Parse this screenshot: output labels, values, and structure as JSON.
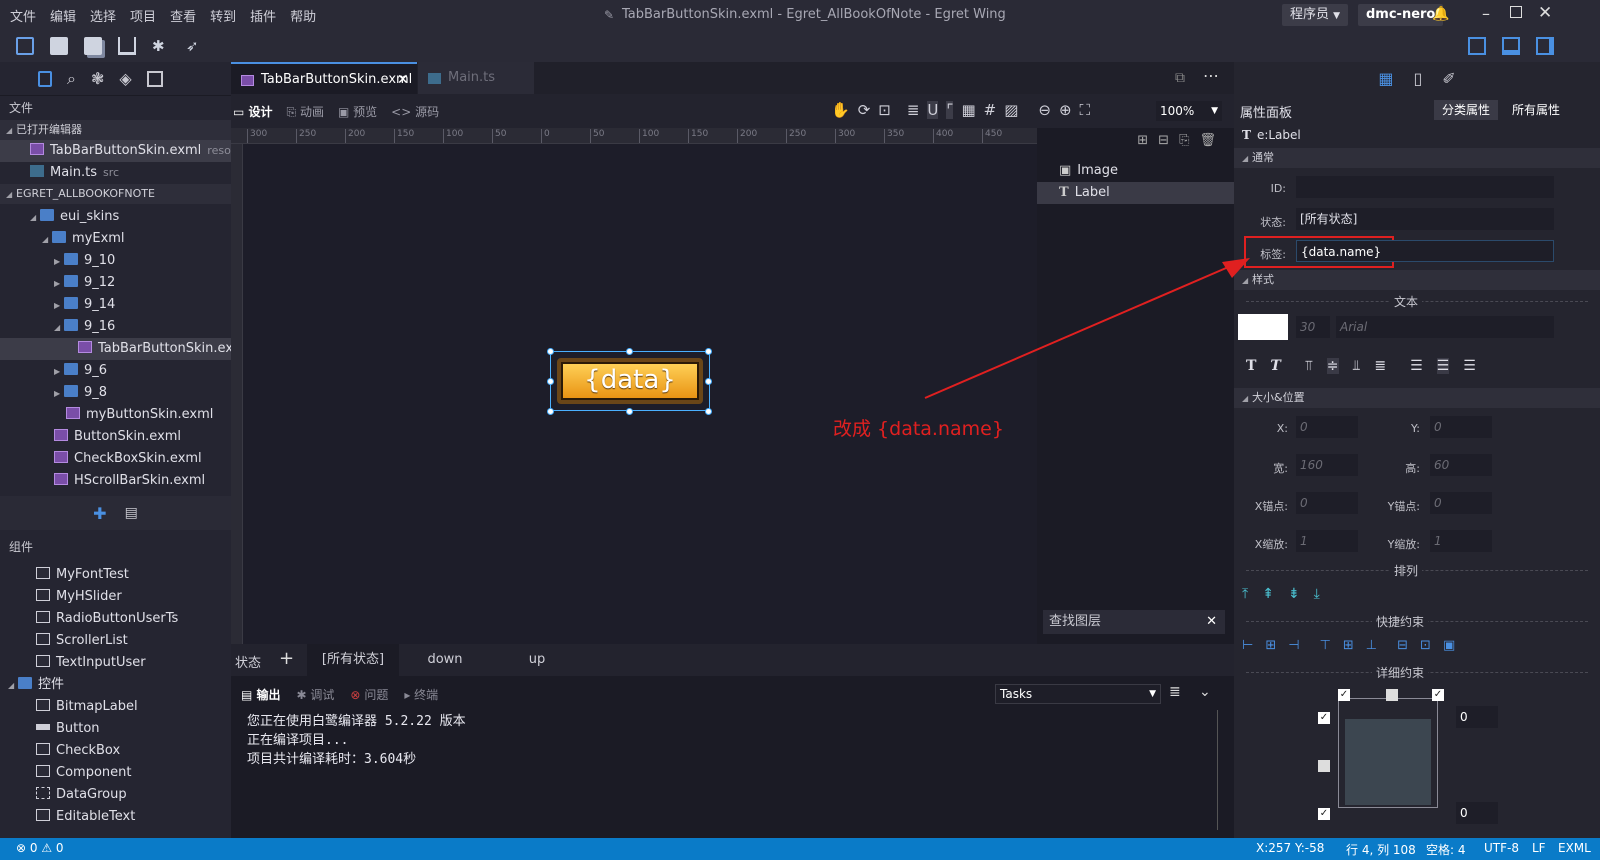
{
  "menu": [
    "文件",
    "编辑",
    "选择",
    "项目",
    "查看",
    "转到",
    "插件",
    "帮助"
  ],
  "window_title": "TabBarButtonSkin.exml - Egret_AllBookOfNote - Egret Wing",
  "role_select": "程序员",
  "user": "dmc-nero",
  "left": {
    "files_label": "文件",
    "open_editors": "已打开编辑器",
    "open_files": [
      {
        "name": "TabBarButtonSkin.exml",
        "hint": "resour..."
      },
      {
        "name": "Main.ts",
        "hint": "src"
      }
    ],
    "project": "EGRET_ALLBOOKOFNOTE",
    "tree": [
      "eui_skins",
      "myExml",
      "9_10",
      "9_12",
      "9_14",
      "9_16",
      "TabBarButtonSkin.exml",
      "9_6",
      "9_8",
      "myButtonSkin.exml",
      "ButtonSkin.exml",
      "CheckBoxSkin.exml",
      "HScrollBarSkin.exml"
    ],
    "components_label": "组件",
    "components": [
      "MyFontTest",
      "MyHSlider",
      "RadioButtonUserTs",
      "ScrollerList",
      "TextInputUser"
    ],
    "controls_label": "控件",
    "controls": [
      "BitmapLabel",
      "Button",
      "CheckBox",
      "Component",
      "DataGroup",
      "EditableText"
    ]
  },
  "tabs": [
    "TabBarButtonSkin.exml",
    "Main.ts"
  ],
  "design_modes": [
    "设计",
    "动画",
    "预览",
    "源码"
  ],
  "zoom": "100%",
  "ruler_ticks": [
    "300",
    "250",
    "200",
    "150",
    "100",
    "50",
    "0",
    "50",
    "100",
    "150",
    "200",
    "250",
    "300",
    "350",
    "400",
    "450"
  ],
  "button_text": "{data}",
  "annotation": "改成 {data.name}",
  "layers": [
    "Image",
    "Label"
  ],
  "layer_search": "查找图层",
  "states": {
    "label": "状态",
    "items": [
      "[所有状态]",
      "down",
      "up"
    ]
  },
  "output": {
    "tabs": [
      "输出",
      "调试",
      "问题",
      "终端"
    ],
    "tasks": "Tasks",
    "lines": [
      "您正在使用白鹭编译器 5.2.22 版本",
      "正在编译项目...",
      "项目共计编译耗时：3.604秒"
    ]
  },
  "props": {
    "title": "属性面板",
    "tab_cat": "分类属性",
    "tab_all": "所有属性",
    "element": "e:Label",
    "sec_common": "通常",
    "id_label": "ID:",
    "state_label": "状态:",
    "state_value": "[所有状态]",
    "tag_label": "标签:",
    "tag_value": "{data.name}",
    "sec_style": "样式",
    "text_div": "文本",
    "font_size": "30",
    "font": "Arial",
    "sec_size": "大小&位置",
    "x_label": "X:",
    "x": "0",
    "y_label": "Y:",
    "y": "0",
    "w_label": "宽:",
    "w": "160",
    "h_label": "高:",
    "h": "60",
    "ax_label": "X锚点:",
    "ax": "0",
    "ay_label": "Y锚点:",
    "ay": "0",
    "sx_label": "X缩放:",
    "sx": "1",
    "sy_label": "Y缩放:",
    "sy": "1",
    "arrange": "排列",
    "quick": "快捷约束",
    "detail": "详细约束",
    "c_top": "0",
    "c_bottom": "0"
  },
  "status": {
    "errors": "0",
    "warnings": "0",
    "coords": "X:257 Y:-58",
    "pos": "行 4, 列 108",
    "spaces": "空格: 4",
    "enc": "UTF-8",
    "eol": "LF",
    "lang": "EXML"
  },
  "colors": {
    "accent": "#0a7bc8",
    "highlight": "#e02020",
    "button_gold": "#f0a020"
  }
}
